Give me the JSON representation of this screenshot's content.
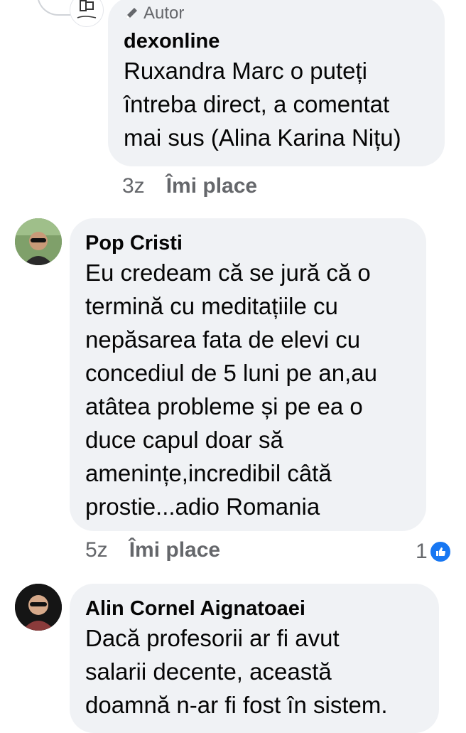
{
  "comments": [
    {
      "badge_label": "Autor",
      "name": "dexonline",
      "text_lines": [
        "Ruxandra Marc o puteți",
        "întreba direct, a comentat",
        "mai sus (Alina Karina Nițu)"
      ],
      "time": "3z",
      "like_label": "Îmi place"
    },
    {
      "name": "Pop Cristi",
      "text_lines": [
        "Eu credeam că se jură că o",
        "termină cu meditațiile cu",
        "nepăsarea fata de elevi cu",
        "concediul de 5 luni pe an,au",
        "atâtea probleme și pe ea o",
        "duce capul doar să",
        "amenințe,incredibil câtă",
        "prostie...adio Romania"
      ],
      "time": "5z",
      "like_label": "Îmi place",
      "reaction_count": "1"
    },
    {
      "name": "Alin Cornel Aignatoaei",
      "text_lines": [
        "Dacă profesorii ar fi avut",
        "salarii decente, această",
        "doamnă n-ar fi fost în sistem."
      ]
    }
  ],
  "colors": {
    "bubble": "#f0f2f5",
    "meta": "#65676b",
    "like_blue": "#1877f2"
  }
}
